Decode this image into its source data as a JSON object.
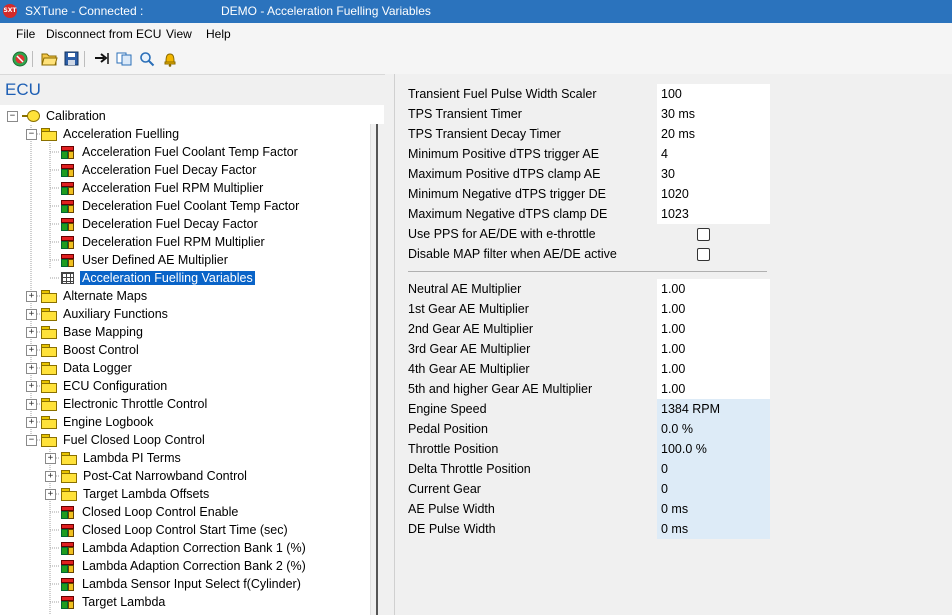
{
  "titlebar": {
    "app_icon_text": "SXT",
    "app_status": "SXTune - Connected :",
    "window_title": "DEMO - Acceleration Fuelling Variables"
  },
  "menu": [
    "File",
    "Disconnect from ECU",
    "View",
    "Help"
  ],
  "toolbar": {
    "icons": [
      "stop-icon",
      "open-folder-icon",
      "save-icon",
      "send-arrow-icon",
      "copy-icon",
      "search-icon",
      "bell-icon"
    ]
  },
  "left_panel": {
    "title": "ECU",
    "tree": [
      {
        "label": "Calibration",
        "icon": "calibration-icon",
        "expander": "−",
        "level": 0
      },
      {
        "label": "Acceleration Fuelling",
        "icon": "folder-icon",
        "expander": "−",
        "level": 1
      },
      {
        "label": "Acceleration Fuel Coolant Temp Factor",
        "icon": "cube-icon",
        "level": 2
      },
      {
        "label": "Acceleration Fuel Decay Factor",
        "icon": "cube-icon",
        "level": 2
      },
      {
        "label": "Acceleration Fuel RPM Multiplier",
        "icon": "cube-icon",
        "level": 2
      },
      {
        "label": "Deceleration Fuel Coolant Temp Factor",
        "icon": "cube-icon",
        "level": 2
      },
      {
        "label": "Deceleration Fuel Decay Factor",
        "icon": "cube-icon",
        "level": 2
      },
      {
        "label": "Deceleration Fuel RPM Multiplier",
        "icon": "cube-icon",
        "level": 2
      },
      {
        "label": "User Defined AE Multiplier",
        "icon": "cube-icon",
        "level": 2
      },
      {
        "label": "Acceleration Fuelling Variables",
        "icon": "grid-icon",
        "level": 2,
        "selected": true
      },
      {
        "label": "Alternate Maps",
        "icon": "folder-icon",
        "expander": "+",
        "level": 1
      },
      {
        "label": "Auxiliary Functions",
        "icon": "folder-icon",
        "expander": "+",
        "level": 1
      },
      {
        "label": "Base Mapping",
        "icon": "folder-icon",
        "expander": "+",
        "level": 1
      },
      {
        "label": "Boost Control",
        "icon": "folder-icon",
        "expander": "+",
        "level": 1
      },
      {
        "label": "Data Logger",
        "icon": "folder-icon",
        "expander": "+",
        "level": 1
      },
      {
        "label": "ECU Configuration",
        "icon": "folder-icon",
        "expander": "+",
        "level": 1
      },
      {
        "label": "Electronic Throttle Control",
        "icon": "folder-icon",
        "expander": "+",
        "level": 1
      },
      {
        "label": "Engine Logbook",
        "icon": "folder-icon",
        "expander": "+",
        "level": 1
      },
      {
        "label": "Fuel Closed Loop Control",
        "icon": "folder-icon",
        "expander": "−",
        "level": 1
      },
      {
        "label": "Lambda PI Terms",
        "icon": "folder-icon",
        "expander": "+",
        "level": 2
      },
      {
        "label": "Post-Cat Narrowband Control",
        "icon": "folder-icon",
        "expander": "+",
        "level": 2
      },
      {
        "label": "Target Lambda Offsets",
        "icon": "folder-icon",
        "expander": "+",
        "level": 2
      },
      {
        "label": "Closed Loop Control Enable",
        "icon": "cube-icon",
        "level": 2
      },
      {
        "label": "Closed Loop Control Start Time (sec)",
        "icon": "cube-icon",
        "level": 2
      },
      {
        "label": "Lambda Adaption Correction Bank 1 (%)",
        "icon": "cube-icon",
        "level": 2
      },
      {
        "label": "Lambda Adaption Correction Bank 2 (%)",
        "icon": "cube-icon",
        "level": 2
      },
      {
        "label": "Lambda Sensor Input Select f(Cylinder)",
        "icon": "cube-icon",
        "level": 2
      },
      {
        "label": "Target Lambda",
        "icon": "cube-icon",
        "level": 2
      }
    ]
  },
  "right_panel": {
    "section1": [
      {
        "label": "Transient Fuel Pulse Width Scaler",
        "value": "100"
      },
      {
        "label": "TPS Transient Timer",
        "value": "30 ms"
      },
      {
        "label": "TPS Transient Decay Timer",
        "value": "20 ms"
      },
      {
        "label": "Minimum Positive dTPS trigger AE",
        "value": "4"
      },
      {
        "label": "Maximum Positive dTPS clamp AE",
        "value": "30"
      },
      {
        "label": "Minimum Negative dTPS trigger DE",
        "value": "1020"
      },
      {
        "label": "Maximum Negative dTPS clamp DE",
        "value": "1023"
      },
      {
        "label": "Use PPS for AE/DE with e-throttle",
        "checkbox": false
      },
      {
        "label": "Disable MAP filter when AE/DE active",
        "checkbox": false
      }
    ],
    "section2": [
      {
        "label": "Neutral AE Multiplier",
        "value": "1.00"
      },
      {
        "label": "1st Gear AE Multiplier",
        "value": "1.00"
      },
      {
        "label": "2nd Gear AE Multiplier",
        "value": "1.00"
      },
      {
        "label": "3rd Gear AE Multiplier",
        "value": "1.00"
      },
      {
        "label": "4th Gear AE Multiplier",
        "value": "1.00"
      },
      {
        "label": "5th and higher Gear AE Multiplier",
        "value": "1.00"
      },
      {
        "label": "Engine Speed",
        "value": "1384 RPM",
        "readonly": true
      },
      {
        "label": "Pedal Position",
        "value": "0.0 %",
        "readonly": true
      },
      {
        "label": "Throttle Position",
        "value": "100.0 %",
        "readonly": true
      },
      {
        "label": "Delta Throttle Position",
        "value": "0",
        "readonly": true
      },
      {
        "label": "Current Gear",
        "value": "0",
        "readonly": true
      },
      {
        "label": "AE Pulse Width",
        "value": "0 ms",
        "readonly": true
      },
      {
        "label": "DE Pulse Width",
        "value": "0 ms",
        "readonly": true
      }
    ]
  },
  "colors": {
    "titlebar": "#2b73bd",
    "selection": "#0a64c8",
    "readonly_field": "#ddebf7",
    "ecu_label": "#1e5fb4"
  }
}
